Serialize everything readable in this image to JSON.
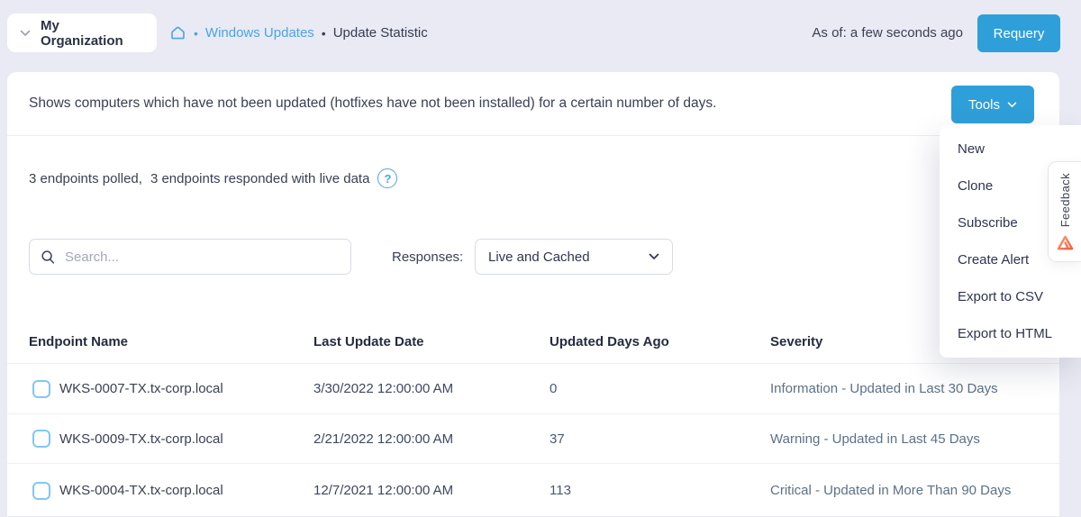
{
  "colors": {
    "accent_blue": "#2f9fd9",
    "link_blue": "#4ba4e5",
    "page_background": "#e9eaf3",
    "panel_background": "#ffffff",
    "severity_text": "#5c7186",
    "feedback_logo_coral": "#f4795b"
  },
  "icons": {
    "bullet": "•",
    "help_glyph": "?"
  },
  "topbar": {
    "org_label": "My Organization",
    "breadcrumb": {
      "link": "Windows Updates",
      "current": "Update Statistic"
    },
    "as_of": "As of: a few seconds ago",
    "requery_label": "Requery"
  },
  "panel": {
    "description": "Shows computers which have not been updated (hotfixes have not been installed) for a certain number of days.",
    "tools_label": "Tools",
    "status": {
      "polled": "3 endpoints polled,",
      "responded": "3 endpoints responded with live data"
    },
    "search_placeholder": "Search...",
    "responses_label": "Responses:",
    "responses_value": "Live and Cached"
  },
  "tools_menu": {
    "items": [
      "New",
      "Clone",
      "Subscribe",
      "Create Alert",
      "Export to CSV",
      "Export to HTML"
    ]
  },
  "feedback": {
    "label": "Feedback"
  },
  "table": {
    "headers": [
      "Endpoint Name",
      "Last Update Date",
      "Updated Days Ago",
      "Severity"
    ],
    "rows": [
      {
        "endpoint": "WKS-0007-TX.tx-corp.local",
        "last_update": "3/30/2022 12:00:00 AM",
        "days_ago": "0",
        "severity": "Information - Updated in Last 30 Days"
      },
      {
        "endpoint": "WKS-0009-TX.tx-corp.local",
        "last_update": "2/21/2022 12:00:00 AM",
        "days_ago": "37",
        "severity": "Warning - Updated in Last 45 Days"
      },
      {
        "endpoint": "WKS-0004-TX.tx-corp.local",
        "last_update": "12/7/2021 12:00:00 AM",
        "days_ago": "113",
        "severity": "Critical - Updated in More Than 90 Days"
      }
    ]
  }
}
